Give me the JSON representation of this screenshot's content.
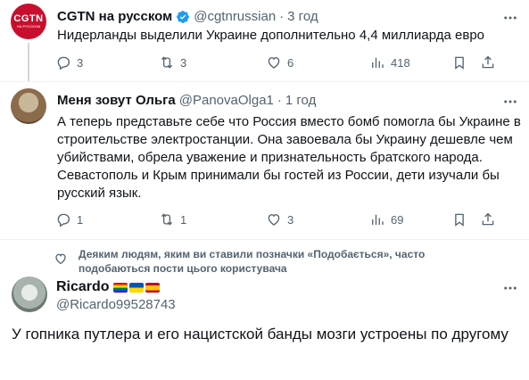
{
  "posts": [
    {
      "name": "CGTN на русском",
      "handle": "@cgtnrussian",
      "separator": "·",
      "time": "3 год",
      "text": "Нидерланды выделили Украине дополнительно 4,4 миллиарда евро",
      "avatar_label": "CGTN",
      "avatar_sublabel": "НА РУССКОМ",
      "actions": {
        "replies": "3",
        "reposts": "3",
        "likes": "6",
        "views": "418"
      }
    },
    {
      "name": "Меня зовут Ольга",
      "handle": "@PanovaOlga1",
      "separator": "·",
      "time": "1 год",
      "text": "А теперь представьте себе что Россия вместо бомб помогла бы Украине в строительстве электростанции. Она завоевала бы Украину дешевле чем убийствами, обрела уважение и признательность братского народа. Севастополь и Крым принимали бы гостей из России, дети изучали бы русский язык.",
      "actions": {
        "replies": "1",
        "reposts": "1",
        "likes": "3",
        "views": "69"
      }
    }
  ],
  "notice": "Деяким людям, яким ви ставили позначки «Подобається», часто подобаються пости цього користувача",
  "reply": {
    "name": "Ricardo",
    "handle": "@Ricardo99528743",
    "text": "У гопника путлера и его нацистской банды мозги устроены по другому"
  },
  "colors": {
    "verified": "#1d9bf0",
    "cgtn_red": "#c8102e",
    "muted": "#536471",
    "divider": "#eff3f4"
  }
}
